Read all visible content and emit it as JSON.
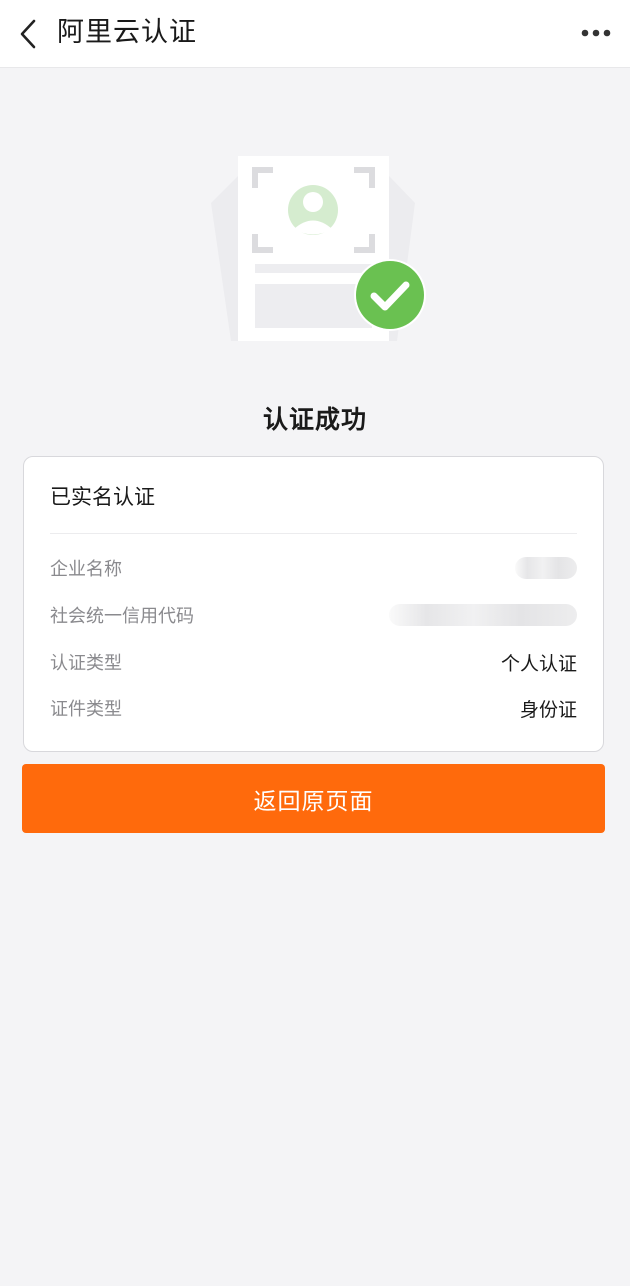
{
  "navbar": {
    "title": "阿里云认证",
    "back_icon": "chevron-left-icon",
    "more_icon": "more-horizontal-icon"
  },
  "hero": {
    "illustration": "id-card-verified-illustration",
    "check_color": "#6ac151",
    "title": "认证成功"
  },
  "card": {
    "header": "已实名认证",
    "rows": [
      {
        "label": "企业名称",
        "value": ""
      },
      {
        "label": "社会统一信用代码",
        "value": ""
      },
      {
        "label": "认证类型",
        "value": "个人认证"
      },
      {
        "label": "证件类型",
        "value": "身份证"
      }
    ]
  },
  "action": {
    "return_label": "返回原页面",
    "color": "#ff6a0c"
  }
}
